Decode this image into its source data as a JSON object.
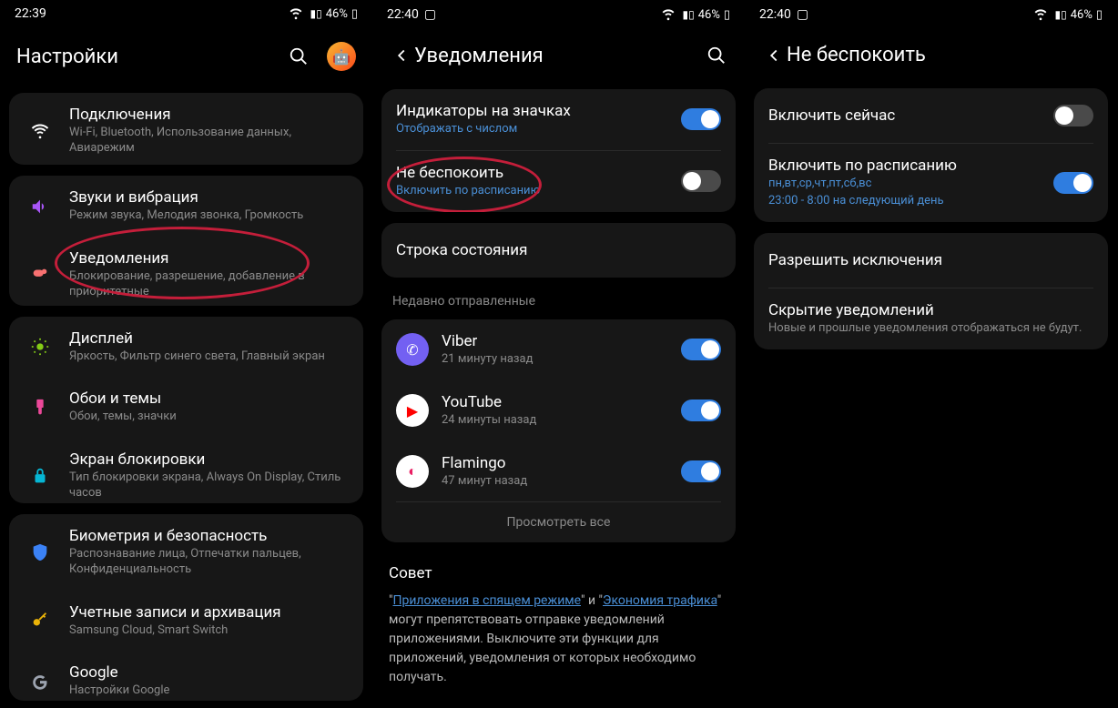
{
  "screen1": {
    "status": {
      "time": "22:39",
      "battery": "46%"
    },
    "title": "Настройки",
    "items": [
      {
        "icon": "wifi",
        "title": "Подключения",
        "sub": "Wi-Fi, Bluetooth, Использование данных, Авиарежим"
      },
      {
        "icon": "sound",
        "title": "Звуки и вибрация",
        "sub": "Режим звука, Мелодия звонка, Громкость"
      },
      {
        "icon": "notif",
        "title": "Уведомления",
        "sub": "Блокирование, разрешение, добавление в приоритетные"
      },
      {
        "icon": "display",
        "title": "Дисплей",
        "sub": "Яркость, Фильтр синего света, Главный экран"
      },
      {
        "icon": "wallpaper",
        "title": "Обои и темы",
        "sub": "Обои, темы, значки"
      },
      {
        "icon": "lock",
        "title": "Экран блокировки",
        "sub": "Тип блокировки экрана, Always On Display, Стиль часов"
      },
      {
        "icon": "shield",
        "title": "Биометрия и безопасность",
        "sub": "Распознавание лица, Отпечатки пальцев, Конфиденциальность"
      },
      {
        "icon": "key",
        "title": "Учетные записи и архивация",
        "sub": "Samsung Cloud, Smart Switch"
      },
      {
        "icon": "google",
        "title": "Google",
        "sub": "Настройки Google"
      }
    ]
  },
  "screen2": {
    "status": {
      "time": "22:40",
      "battery": "46%"
    },
    "title": "Уведомления",
    "badge_indicators": {
      "title": "Индикаторы на значках",
      "sub": "Отображать с числом",
      "on": true
    },
    "dnd": {
      "title": "Не беспокоить",
      "sub": "Включить по расписанию",
      "on": false
    },
    "status_bar": {
      "title": "Строка состояния"
    },
    "recent_label": "Недавно отправленные",
    "apps": [
      {
        "name": "Viber",
        "sub": "21 минуту назад",
        "icon": "viber",
        "on": true
      },
      {
        "name": "YouTube",
        "sub": "24 минуты назад",
        "icon": "youtube",
        "on": true
      },
      {
        "name": "Flamingo",
        "sub": "47 минут назад",
        "icon": "flamingo",
        "on": true
      }
    ],
    "view_all": "Просмотреть все",
    "tip_title": "Совет",
    "tip_body_pre": "\"",
    "tip_link1": "Приложения в спящем режиме",
    "tip_body_mid": "\" и \"",
    "tip_link2": "Экономия трафика",
    "tip_body_post": "\" могут препятствовать отправке уведомлений приложениями. Выключите эти функции для приложений, уведомления от которых необходимо получать."
  },
  "screen3": {
    "status": {
      "time": "22:40",
      "battery": "46%"
    },
    "title": "Не беспокоить",
    "enable_now": {
      "title": "Включить сейчас",
      "on": false
    },
    "schedule": {
      "title": "Включить по расписанию",
      "sub1": "пн,вт,ср,чт,пт,сб,вс",
      "sub2": "23:00 - 8:00 на следующий день",
      "on": true
    },
    "exceptions": {
      "title": "Разрешить исключения"
    },
    "hide": {
      "title": "Скрытие уведомлений",
      "sub": "Новые и прошлые уведомления отображаться не будут."
    }
  }
}
